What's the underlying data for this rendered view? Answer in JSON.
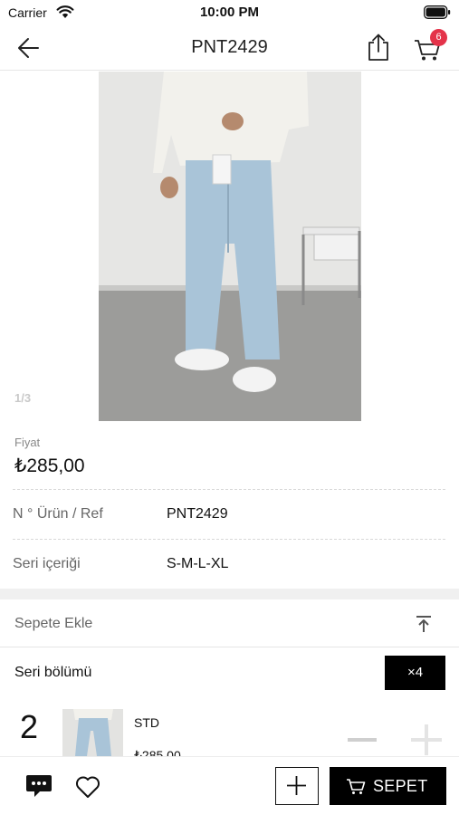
{
  "status_bar": {
    "carrier": "Carrier",
    "time": "10:00 PM"
  },
  "nav": {
    "title": "PNT2429",
    "cart_badge": "6"
  },
  "gallery": {
    "counter": "1/3"
  },
  "price": {
    "label": "Fiyat",
    "value": "₺285,00"
  },
  "attributes": [
    {
      "label": "N ° Ürün / Ref",
      "value": "PNT2429"
    },
    {
      "label": "Seri içeriği",
      "value": "S-M-L-XL"
    }
  ],
  "add_section": {
    "title": "Sepete Ekle"
  },
  "series": {
    "title": "Seri bölümü",
    "multiplier": "×4",
    "item": {
      "count": "2",
      "name": "STD",
      "price": "₺285,00"
    }
  },
  "bottom_bar": {
    "cart_label": "SEPET"
  },
  "colors": {
    "badge": "#e4334a",
    "primary": "#000000"
  }
}
